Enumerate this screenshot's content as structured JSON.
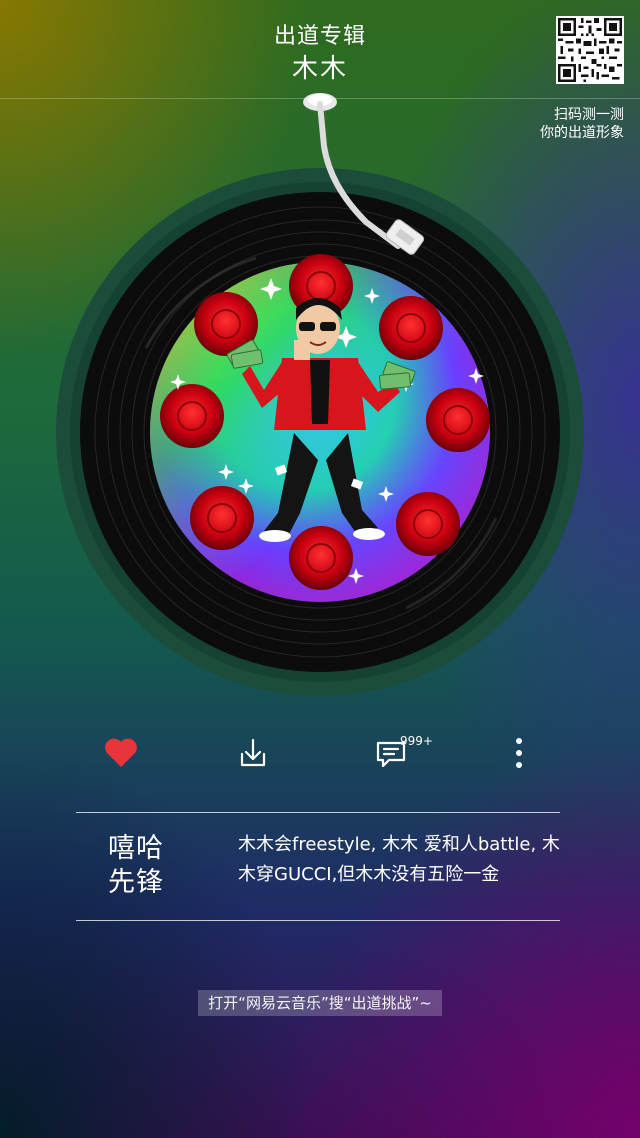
{
  "header": {
    "title": "出道专辑",
    "artist": "木木"
  },
  "qr": {
    "caption_line1": "扫码测一测",
    "caption_line2": "你的出道形象"
  },
  "actions": {
    "like_icon": "heart-icon",
    "like_color": "#e8353b",
    "download_icon": "download-icon",
    "comment_icon": "comment-icon",
    "comment_count": "999+",
    "more_icon": "more-vertical-icon"
  },
  "song": {
    "genre_line1": "嘻哈",
    "genre_line2": "先锋",
    "lyrics": "木木会freestyle, 木木 爱和人battle, 木木穿GUCCI,但木木没有五险一金"
  },
  "footer": {
    "hint": "打开“网易云音乐”搜“出道挑战”~"
  }
}
